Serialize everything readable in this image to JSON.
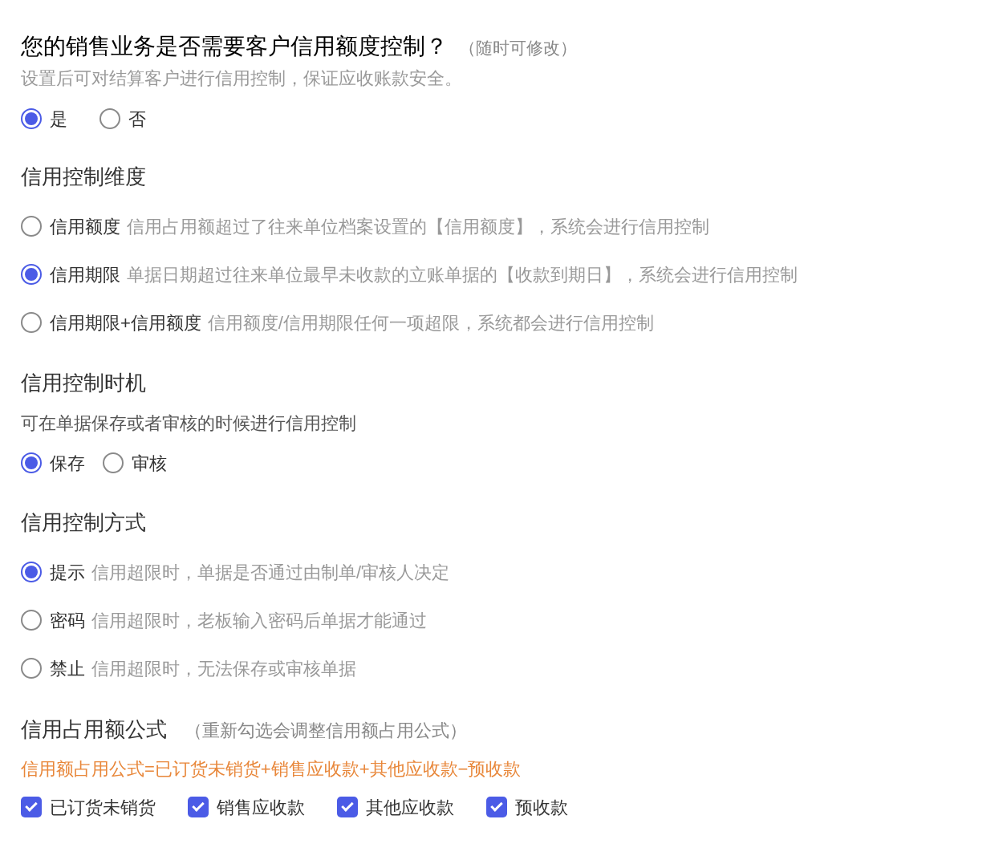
{
  "sections": [
    {
      "kind": "question",
      "title": "您的销售业务是否需要客户信用额度控制？",
      "note": "（随时可修改）",
      "description": "设置后可对结算客户进行信用控制，保证应收账款安全。",
      "options": [
        {
          "label": "是",
          "selected": true
        },
        {
          "label": "否",
          "selected": false
        }
      ]
    },
    {
      "kind": "radio-list",
      "title": "信用控制维度",
      "options": [
        {
          "label": "信用额度",
          "description": "信用占用额超过了往来单位档案设置的【信用额度】，系统会进行信用控制",
          "selected": false
        },
        {
          "label": "信用期限",
          "description": "单据日期超过往来单位最早未收款的立账单据的【收款到期日】，系统会进行信用控制",
          "selected": true
        },
        {
          "label": "信用期限+信用额度",
          "description": "信用额度/信用期限任何一项超限，系统都会进行信用控制",
          "selected": false
        }
      ]
    },
    {
      "kind": "radio-row",
      "title": "信用控制时机",
      "description": "可在单据保存或者审核的时候进行信用控制",
      "options": [
        {
          "label": "保存",
          "selected": true
        },
        {
          "label": "审核",
          "selected": false
        }
      ]
    },
    {
      "kind": "radio-list",
      "title": "信用控制方式",
      "options": [
        {
          "label": "提示",
          "description": "信用超限时，单据是否通过由制单/审核人决定",
          "selected": true
        },
        {
          "label": "密码",
          "description": "信用超限时，老板输入密码后单据才能通过",
          "selected": false
        },
        {
          "label": "禁止",
          "description": "信用超限时，无法保存或审核单据",
          "selected": false
        }
      ]
    },
    {
      "kind": "checkbox-row",
      "title": "信用占用额公式",
      "note": "（重新勾选会调整信用额占用公式）",
      "formula": "信用额占用公式=已订货未销货+销售应收款+其他应收款−预收款",
      "options": [
        {
          "label": "已订货未销货",
          "checked": true
        },
        {
          "label": "销售应收款",
          "checked": true
        },
        {
          "label": "其他应收款",
          "checked": true
        },
        {
          "label": "预收款",
          "checked": true
        }
      ]
    }
  ]
}
